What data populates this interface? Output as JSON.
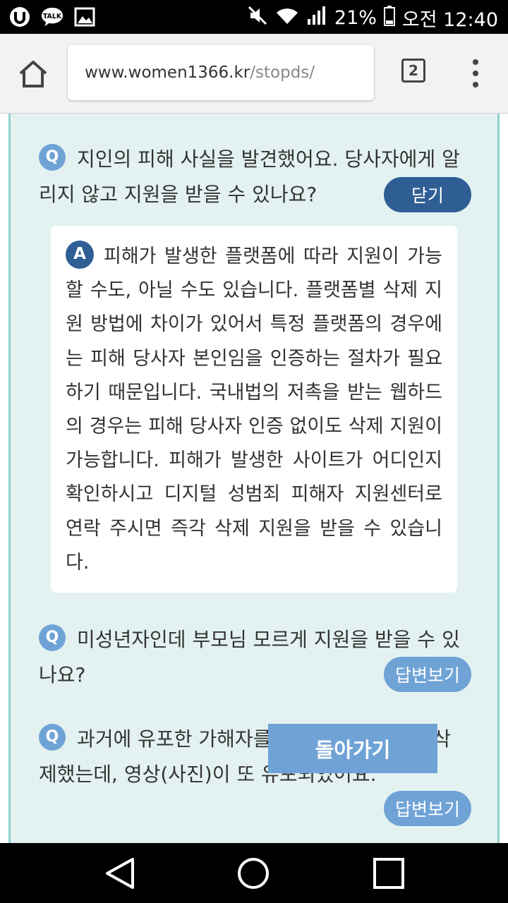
{
  "status_bar": {
    "battery": "21%",
    "time": "오전 12:40",
    "icons": [
      "u-plus-icon",
      "kakaotalk-icon",
      "gallery-icon",
      "mute-icon",
      "wifi-icon",
      "signal-icon",
      "battery-icon"
    ],
    "talk_label": "TALK"
  },
  "browser": {
    "url_host": "www.women1366.kr",
    "url_path": "/stopds/",
    "tab_count": "2"
  },
  "faq": [
    {
      "badge": "Q",
      "question": "지인의 피해 사실을 발견했어요. 당사자에게 알리지 않고 지원을 받을 수 있나요?",
      "button": "닫기",
      "answer_badge": "A",
      "answer": "피해가 발생한 플랫폼에 따라 지원이 가능할 수도, 아닐 수도 있습니다. 플랫폼별 삭제 지원 방법에 차이가 있어서 특정 플랫폼의 경우에는 피해 당사자 본인임을 인증하는 절차가 필요하기 때문입니다. 국내법의 저촉을 받는 웹하드의 경우는 피해 당사자 인증 없이도 삭제 지원이 가능합니다. 피해가 발생한 사이트가 어디인지 확인하시고 디지털 성범죄 피해자 지원센터로 연락 주시면 즉각 삭제 지원을 받을 수 있습니다."
    },
    {
      "badge": "Q",
      "question": "미성년자인데 부모님 모르게 지원을 받을 수 있나요?",
      "button": "답변보기"
    },
    {
      "badge": "Q",
      "question": "과거에 유포한 가해자를 통해 영상(사진)을 삭제했는데, 영상(사진)이 또 유포되었어요.",
      "button": "답변보기"
    }
  ],
  "back_button": "돌아가기",
  "colors": {
    "panel_bg": "#e3f2f1",
    "panel_border": "#8fd0cd",
    "accent_dark": "#2f5e95",
    "accent_light": "#6fa3d6"
  }
}
